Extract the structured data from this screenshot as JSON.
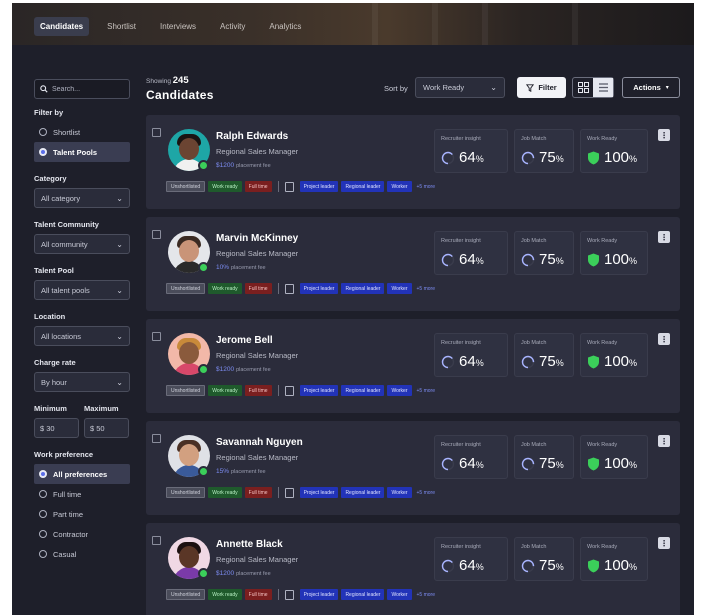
{
  "header": {
    "tabs": [
      {
        "label": "Candidates",
        "active": true
      },
      {
        "label": "Shortlist",
        "active": false
      },
      {
        "label": "Interviews",
        "active": false
      },
      {
        "label": "Activity",
        "active": false
      },
      {
        "label": "Analytics",
        "active": false
      }
    ]
  },
  "sidebar": {
    "search_placeholder": "Search...",
    "filter_by_label": "Filter by",
    "filter_by_options": [
      {
        "label": "Shortlist",
        "selected": false
      },
      {
        "label": "Talent Pools",
        "selected": true
      }
    ],
    "category": {
      "label": "Category",
      "value": "All category"
    },
    "talent_community": {
      "label": "Talent Community",
      "value": "All community"
    },
    "talent_pool": {
      "label": "Talent Pool",
      "value": "All talent pools"
    },
    "location": {
      "label": "Location",
      "value": "All locations"
    },
    "charge_rate": {
      "label": "Charge rate",
      "value": "By hour"
    },
    "minimum": {
      "label": "Minimum",
      "value": "$ 30"
    },
    "maximum": {
      "label": "Maximum",
      "value": "$ 50"
    },
    "work_preference_label": "Work preference",
    "work_preferences": [
      {
        "label": "All preferences",
        "selected": true
      },
      {
        "label": "Full time",
        "selected": false
      },
      {
        "label": "Part time",
        "selected": false
      },
      {
        "label": "Contractor",
        "selected": false
      },
      {
        "label": "Casual",
        "selected": false
      }
    ]
  },
  "main": {
    "showing_label": "Showing",
    "count": "245",
    "title": "Candidates",
    "sort_label": "Sort by",
    "sort_value": "Work Ready",
    "filter_label": "Filter",
    "actions_label": "Actions",
    "metric_labels": {
      "recruiter": "Recruiter insight",
      "match": "Job Match",
      "ready": "Work Ready"
    },
    "tag_labels": [
      "Unshortlisted",
      "Work ready",
      "Full time"
    ],
    "skill_labels": [
      "Project leader",
      "Regional leader",
      "Worker"
    ],
    "more_label": "+5 more",
    "candidates": [
      {
        "name": "Ralph Edwards",
        "role": "Regional Sales Manager",
        "rate": "$1200",
        "rate_suffix": "placement fee",
        "recruiter_value": "64",
        "match_value": "75",
        "ready_value": "100",
        "percent_sign": "%",
        "recruiter_fraction": 0.64,
        "match_fraction": 0.75,
        "ready_fraction": 1.0,
        "avatar_bg": "#1ea6a6",
        "skin": "#6b4432",
        "hair": "#1a1412",
        "shirt": "#f0f0f0"
      },
      {
        "name": "Marvin McKinney",
        "role": "Regional Sales Manager",
        "rate": "10%",
        "rate_suffix": "placement fee",
        "recruiter_value": "64",
        "match_value": "75",
        "ready_value": "100",
        "percent_sign": "%",
        "recruiter_fraction": 0.64,
        "match_fraction": 0.75,
        "ready_fraction": 1.0,
        "avatar_bg": "#e4e6ea",
        "skin": "#c99478",
        "hair": "#3a2a22",
        "shirt": "#2a2a2a"
      },
      {
        "name": "Jerome Bell",
        "role": "Regional Sales Manager",
        "rate": "$1200",
        "rate_suffix": "placement fee",
        "recruiter_value": "64",
        "match_value": "75",
        "ready_value": "100",
        "percent_sign": "%",
        "recruiter_fraction": 0.64,
        "match_fraction": 0.75,
        "ready_fraction": 1.0,
        "avatar_bg": "#f2b8a8",
        "skin": "#8a5a3c",
        "hair": "#c88a3a",
        "shirt": "#d8486a"
      },
      {
        "name": "Savannah Nguyen",
        "role": "Regional Sales Manager",
        "rate": "15%",
        "rate_suffix": "placement fee",
        "recruiter_value": "64",
        "match_value": "75",
        "ready_value": "100",
        "percent_sign": "%",
        "recruiter_fraction": 0.64,
        "match_fraction": 0.75,
        "ready_fraction": 1.0,
        "avatar_bg": "#dfe1e6",
        "skin": "#d2a080",
        "hair": "#4a3024",
        "shirt": "#3a5a9a"
      },
      {
        "name": "Annette Black",
        "role": "Regional Sales Manager",
        "rate": "$1200",
        "rate_suffix": "placement fee",
        "recruiter_value": "64",
        "match_value": "75",
        "ready_value": "100",
        "percent_sign": "%",
        "recruiter_fraction": 0.64,
        "match_fraction": 0.75,
        "ready_fraction": 1.0,
        "avatar_bg": "#f0d8e4",
        "skin": "#5a3626",
        "hair": "#1c1010",
        "shirt": "#7a3aa8"
      }
    ]
  },
  "colors": {
    "accent": "#5b6ee8",
    "ready_green": "#3bcf5a",
    "ring": "#a8b4ff"
  }
}
